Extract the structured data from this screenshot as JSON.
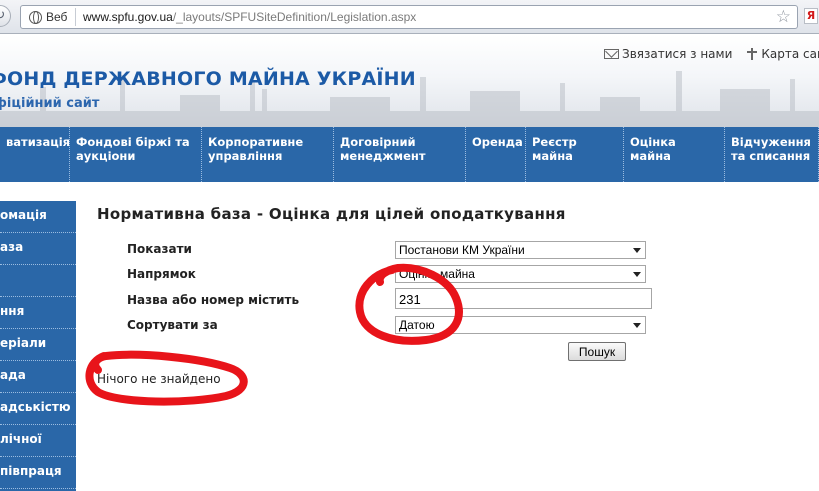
{
  "browser": {
    "chip_label": "Веб",
    "url_host": "www.spfu.gov.ua",
    "url_path": "/_layouts/SPFUSiteDefinition/Legislation.aspx",
    "extension_glyph": "Я"
  },
  "header": {
    "title": "ФОНД ДЕРЖАВНОГО МАЙНА УКРАЇНИ",
    "subtitle": "фіційний сайт",
    "contact_link": "Звязатися з нами",
    "sitemap_link": "Карта сай"
  },
  "topnav": [
    {
      "label": "ватизація",
      "width": 70
    },
    {
      "label": "Фондові біржі та аукціони",
      "width": 132
    },
    {
      "label": "Корпоративне управління",
      "width": 132
    },
    {
      "label": "Договірний менеджмент",
      "width": 132
    },
    {
      "label": "Оренда",
      "width": 60
    },
    {
      "label": "Реєстр майна",
      "width": 98
    },
    {
      "label": "Оцінка майна",
      "width": 101
    },
    {
      "label": "Відчуження та списання",
      "width": 94
    }
  ],
  "sidebar": [
    {
      "label": "омація"
    },
    {
      "label": "аза"
    },
    {
      "label": ""
    },
    {
      "label": "ння"
    },
    {
      "label": "еріали"
    },
    {
      "label": "ада"
    },
    {
      "label": "адськістю"
    },
    {
      "label": "лічної"
    },
    {
      "label": "півпраця"
    }
  ],
  "main": {
    "page_title": "Нормативна база - Оцінка для цілей оподаткування",
    "show_label": "Показати",
    "show_value": "Постанови КМ України",
    "direction_label": "Напрямок",
    "direction_value": "Оцінка майна",
    "name_label": "Назва або номер містить",
    "name_value": "231",
    "sort_label": "Сортувати за",
    "sort_value": "Датою",
    "search_button": "Пошук",
    "result_message": "Нічого не знайдено"
  },
  "colors": {
    "nav_blue": "#2a67a8",
    "title_blue": "#1c5aa6",
    "annotation_red": "#e8141a"
  }
}
